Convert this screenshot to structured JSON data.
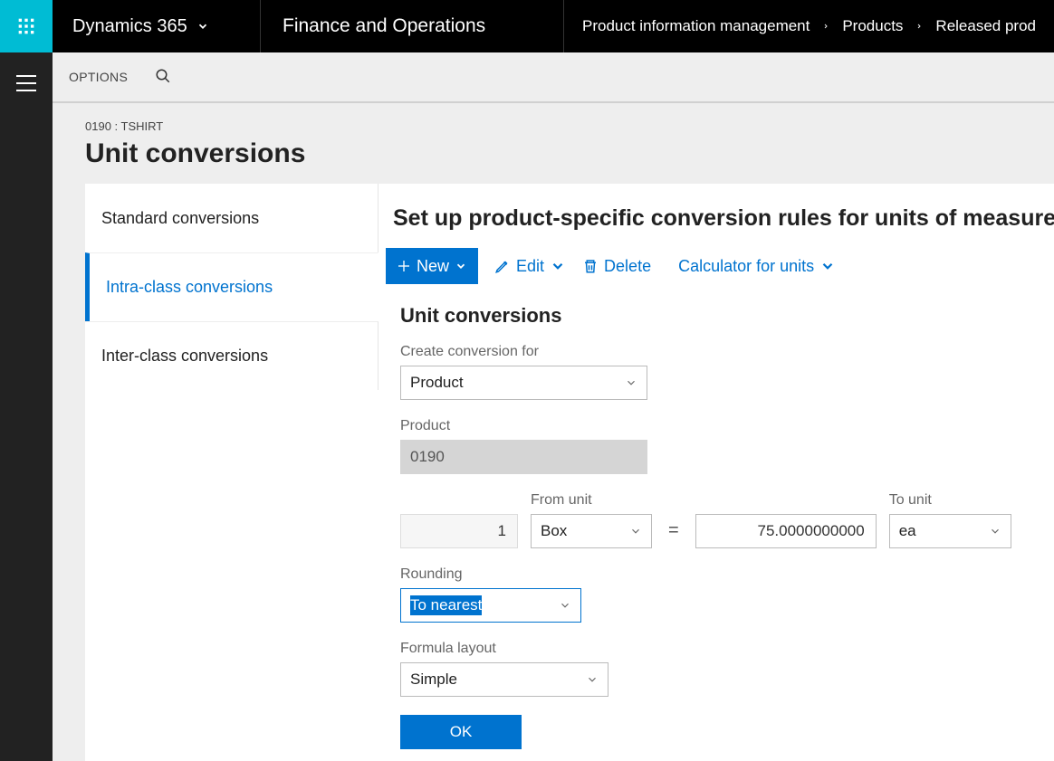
{
  "topbar": {
    "brand": "Dynamics 365",
    "app": "Finance and Operations",
    "breadcrumbs": [
      "Product information management",
      "Products",
      "Released prod"
    ]
  },
  "options_label": "OPTIONS",
  "context": {
    "id": "0190 : TSHIRT",
    "title": "Unit conversions"
  },
  "tabs": [
    {
      "label": "Standard conversions",
      "active": false
    },
    {
      "label": "Intra-class conversions",
      "active": true
    },
    {
      "label": "Inter-class conversions",
      "active": false
    }
  ],
  "panel": {
    "heading": "Set up product-specific conversion rules for units of measure in the sam",
    "actions": {
      "new": "New",
      "edit": "Edit",
      "delete": "Delete",
      "calc": "Calculator for units"
    },
    "dialog": {
      "title": "Unit conversions",
      "create_for_label": "Create conversion for",
      "create_for": "Product",
      "product_label": "Product",
      "product": "0190",
      "from_qty": "1",
      "from_unit_label": "From unit",
      "from_unit": "Box",
      "factor": "75.0000000000",
      "to_unit_label": "To unit",
      "to_unit": "ea",
      "rounding_label": "Rounding",
      "rounding": "To nearest",
      "formula_label": "Formula layout",
      "formula": "Simple",
      "ok": "OK"
    }
  }
}
